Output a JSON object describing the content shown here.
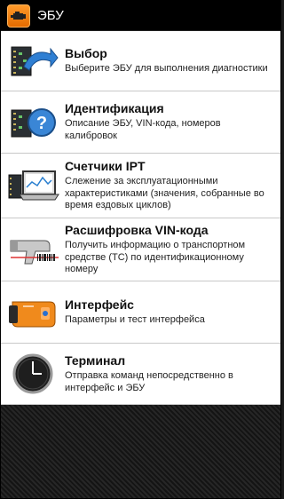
{
  "app": {
    "title": "ЭБУ"
  },
  "menu": [
    {
      "id": "select",
      "title": "Выбор",
      "description": "Выберите ЭБУ для выполнения диагностики",
      "icon": "ecu-arrow-icon"
    },
    {
      "id": "identification",
      "title": "Идентификация",
      "description": "Описание ЭБУ, VIN-кода, номеров калибровок",
      "icon": "ecu-question-icon"
    },
    {
      "id": "counters",
      "title": "Счетчики IPT",
      "description": "Слежение за эксплуатационными характеристиками (значения, собранные во время ездовых циклов)",
      "icon": "ecu-laptop-icon"
    },
    {
      "id": "vin",
      "title": "Расшифровка VIN-кода",
      "description": "Получить информацию о транспортном средстве (ТС) по идентификационному номеру",
      "icon": "barcode-scanner-icon"
    },
    {
      "id": "interface",
      "title": "Интерфейс",
      "description": "Параметры и тест интерфейса",
      "icon": "obd-adapter-icon"
    },
    {
      "id": "terminal",
      "title": "Терминал",
      "description": "Отправка команд непосредственно в интерфейс и ЭБУ",
      "icon": "terminal-icon"
    }
  ]
}
